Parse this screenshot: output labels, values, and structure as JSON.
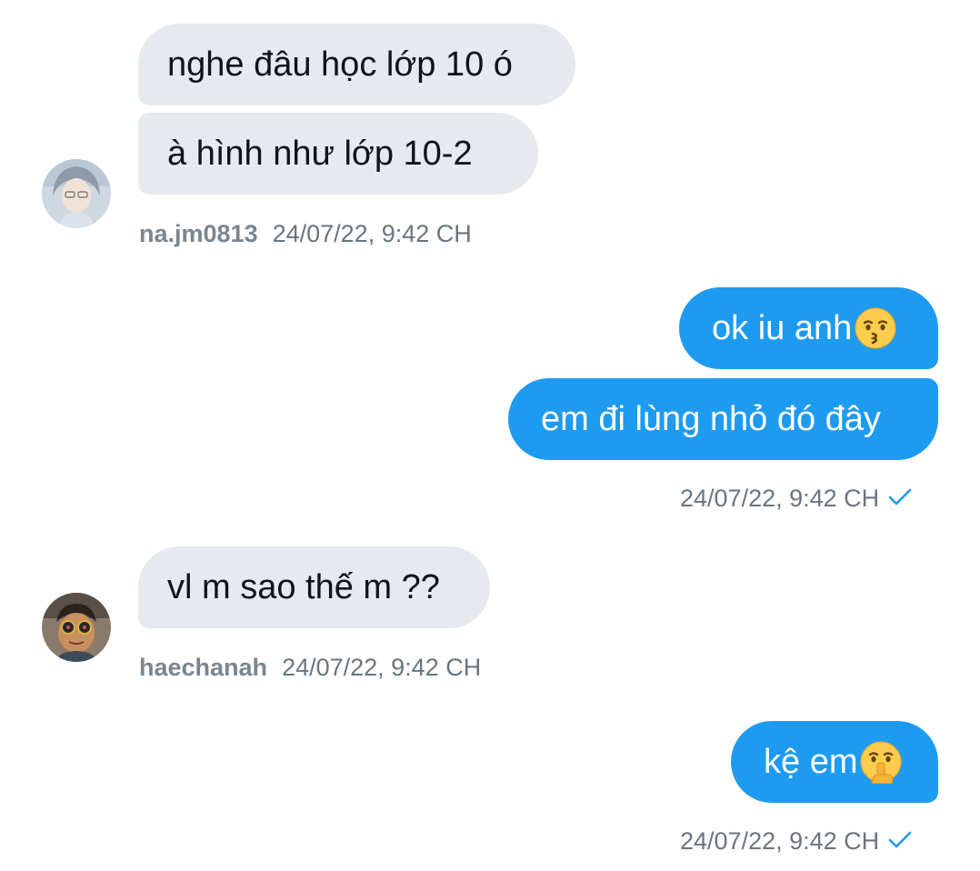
{
  "conversation": [
    {
      "direction": "incoming",
      "username": "na.jm0813",
      "timestamp": "24/07/22, 9:42 CH",
      "messages": [
        "nghe đâu học lớp 10 ó",
        "à hình như lớp 10-2"
      ]
    },
    {
      "direction": "outgoing",
      "timestamp": "24/07/22, 9:42 CH",
      "messages": [
        "ok iu anh",
        "em đi lùng nhỏ đó đây"
      ],
      "emoji": "kissing-face-icon"
    },
    {
      "direction": "incoming",
      "username": "haechanah",
      "timestamp": "24/07/22, 9:42 CH",
      "messages": [
        "vl m sao thế m ??"
      ]
    },
    {
      "direction": "outgoing",
      "timestamp": "24/07/22, 9:42 CH",
      "messages": [
        "kệ em"
      ],
      "emoji": "shushing-face-icon"
    }
  ],
  "colors": {
    "incoming_bubble": "#e6eaee",
    "outgoing_bubble": "#1d9bf0",
    "meta_text": "#6b7580",
    "read_check": "#1d9bf0"
  }
}
